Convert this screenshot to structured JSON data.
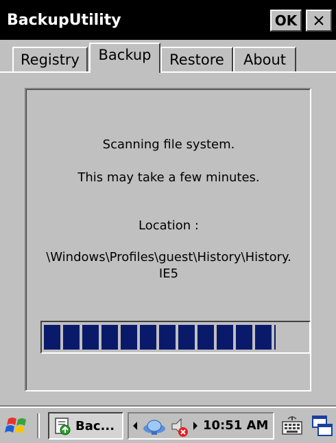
{
  "window": {
    "title": "BackupUtility",
    "ok_label": "OK",
    "close_icon": "close-icon"
  },
  "tabs": [
    {
      "label": "Registry",
      "active": false
    },
    {
      "label": "Backup",
      "active": true
    },
    {
      "label": "Restore",
      "active": false
    },
    {
      "label": "About",
      "active": false
    }
  ],
  "status": {
    "line1": "Scanning file system.",
    "line2": "This may take a few minutes.",
    "location_label": "Location :",
    "location_path_line1": "\\Windows\\Profiles\\guest\\History\\History.",
    "location_path_line2": "IE5"
  },
  "progress": {
    "value": 0.88,
    "fill_color": "#0a1a6b",
    "segments_filled": 12
  },
  "taskbar": {
    "start_icon": "windows-flag-icon",
    "app_button_label": "Bac...",
    "app_icon": "backup-app-icon",
    "tray_icons": [
      "chevron-left-icon",
      "network-icon",
      "volume-muted-icon",
      "chevron-right-icon"
    ],
    "clock": "10:51 AM",
    "keyboard_icon": "keyboard-icon",
    "windows_icon": "switch-windows-icon"
  },
  "colors": {
    "titlebar_bg": "#000000",
    "face": "#c0c0c0",
    "progress": "#0a1a6b"
  }
}
